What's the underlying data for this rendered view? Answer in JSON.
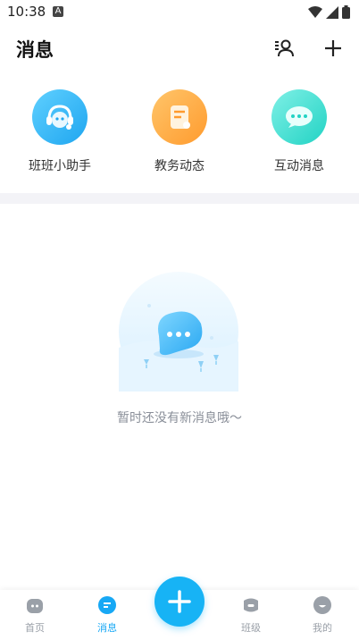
{
  "status": {
    "time": "10:38",
    "notice": "A"
  },
  "header": {
    "title": "消息"
  },
  "quick": [
    {
      "label": "班班小助手",
      "icon": "assistant-headset-icon"
    },
    {
      "label": "教务动态",
      "icon": "document-icon"
    },
    {
      "label": "互动消息",
      "icon": "chat-bubble-icon"
    }
  ],
  "empty": {
    "text": "暂时还没有新消息哦～"
  },
  "tabs": [
    {
      "label": "首页",
      "active": false
    },
    {
      "label": "消息",
      "active": true
    },
    {
      "label": "班级",
      "active": false
    },
    {
      "label": "我的",
      "active": false
    }
  ],
  "colors": {
    "accent": "#17b3f5",
    "inactive": "#9aa0a8"
  }
}
